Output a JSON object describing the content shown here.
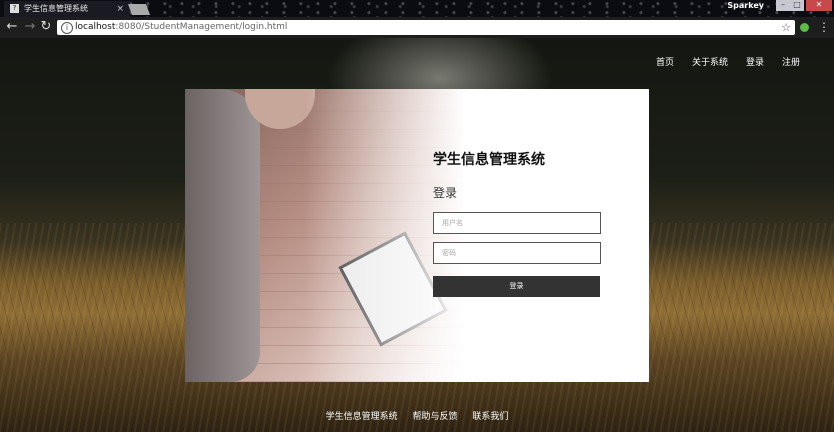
{
  "browser": {
    "tab_title": "学生信息管理系统",
    "tab_close": "×",
    "favicon": "?",
    "user_name": "Sparkey",
    "url_host": "localhost",
    "url_rest": ":8080/StudentManagement/login.html",
    "back": "←",
    "forward": "→",
    "reload": "↻",
    "star": "☆",
    "menu": "⋮",
    "info": "i",
    "minimize": "–",
    "maximize": "□",
    "close": "✕"
  },
  "nav": {
    "items": [
      {
        "label": "首页"
      },
      {
        "label": "关于系统"
      },
      {
        "label": "登录"
      },
      {
        "label": "注册"
      }
    ]
  },
  "login": {
    "title": "学生信息管理系统",
    "subtitle": "登录",
    "username_placeholder": "用户名",
    "password_placeholder": "密码",
    "button": "登录"
  },
  "footer": {
    "links": [
      {
        "label": "学生信息管理系统"
      },
      {
        "label": "帮助与反馈"
      },
      {
        "label": "联系我们"
      }
    ]
  }
}
